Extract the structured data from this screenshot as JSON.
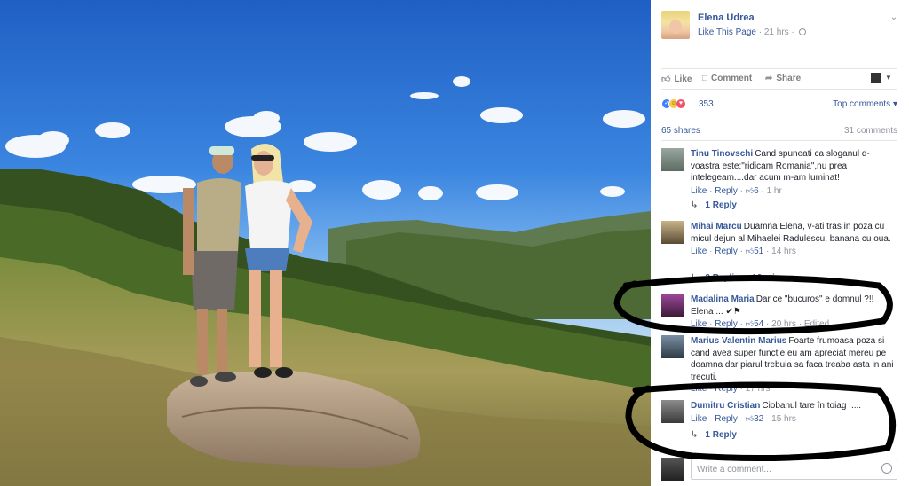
{
  "post": {
    "page_name": "Elena Udrea",
    "like_page": "Like This Page",
    "time": "· 21 hrs ·"
  },
  "actions": {
    "like": "Like",
    "comment": "Comment",
    "share": "Share"
  },
  "reactions": {
    "count": "353",
    "sort_label": "Top comments"
  },
  "stats": {
    "shares": "65 shares",
    "comments": "31 comments"
  },
  "comments": [
    {
      "author": "Tinu Tinovschi",
      "text": "Cand spuneati ca sloganul d-voastra este:\"ridicam Romania\",nu prea intelegeam....dar acum m-am luminat!",
      "like": "Like",
      "reply": "Reply",
      "likes": "6",
      "time": "1 hr",
      "replies": "1 Reply"
    },
    {
      "author": "Mihai Marcu",
      "text": "Duamna Elena, v-ati tras in poza cu micul dejun al Mihaelei Radulescu, banana cu oua.",
      "like": "Like",
      "reply": "Reply",
      "likes": "51",
      "time": "14 hrs",
      "replies": "2 Replies · 10 mins"
    },
    {
      "author": "Madalina Maria",
      "text": "Dar ce \"bucuros\" e domnul ?!! Elena ...",
      "like": "Like",
      "reply": "Reply",
      "likes": "54",
      "time": "20 hrs · Edited"
    },
    {
      "author": "Marius Valentin Marius",
      "text": "Foarte frumoasa poza si cand avea super functie eu am apreciat mereu pe doamna dar piarul trebuia sa faca treaba asta in ani trecuti.",
      "like": "Like",
      "reply": "Reply",
      "time": "17 hrs"
    },
    {
      "author": "Dumitru Cristian",
      "text": "Ciobanul tare în toiag .....",
      "like": "Like",
      "reply": "Reply",
      "likes": "32",
      "time": "15 hrs",
      "replies": "1 Reply"
    }
  ],
  "write_comment": {
    "placeholder": "Write a comment..."
  },
  "icons": {
    "like": "thumbs-up-icon",
    "comment": "speech-bubble-icon",
    "share": "share-arrow-icon",
    "privacy": "globe-icon",
    "emoji": "smiley-icon"
  },
  "colors": {
    "link": "#365899",
    "meta": "#90949c",
    "sky_top": "#1f5fc4",
    "annotation_stroke": "#000000"
  }
}
